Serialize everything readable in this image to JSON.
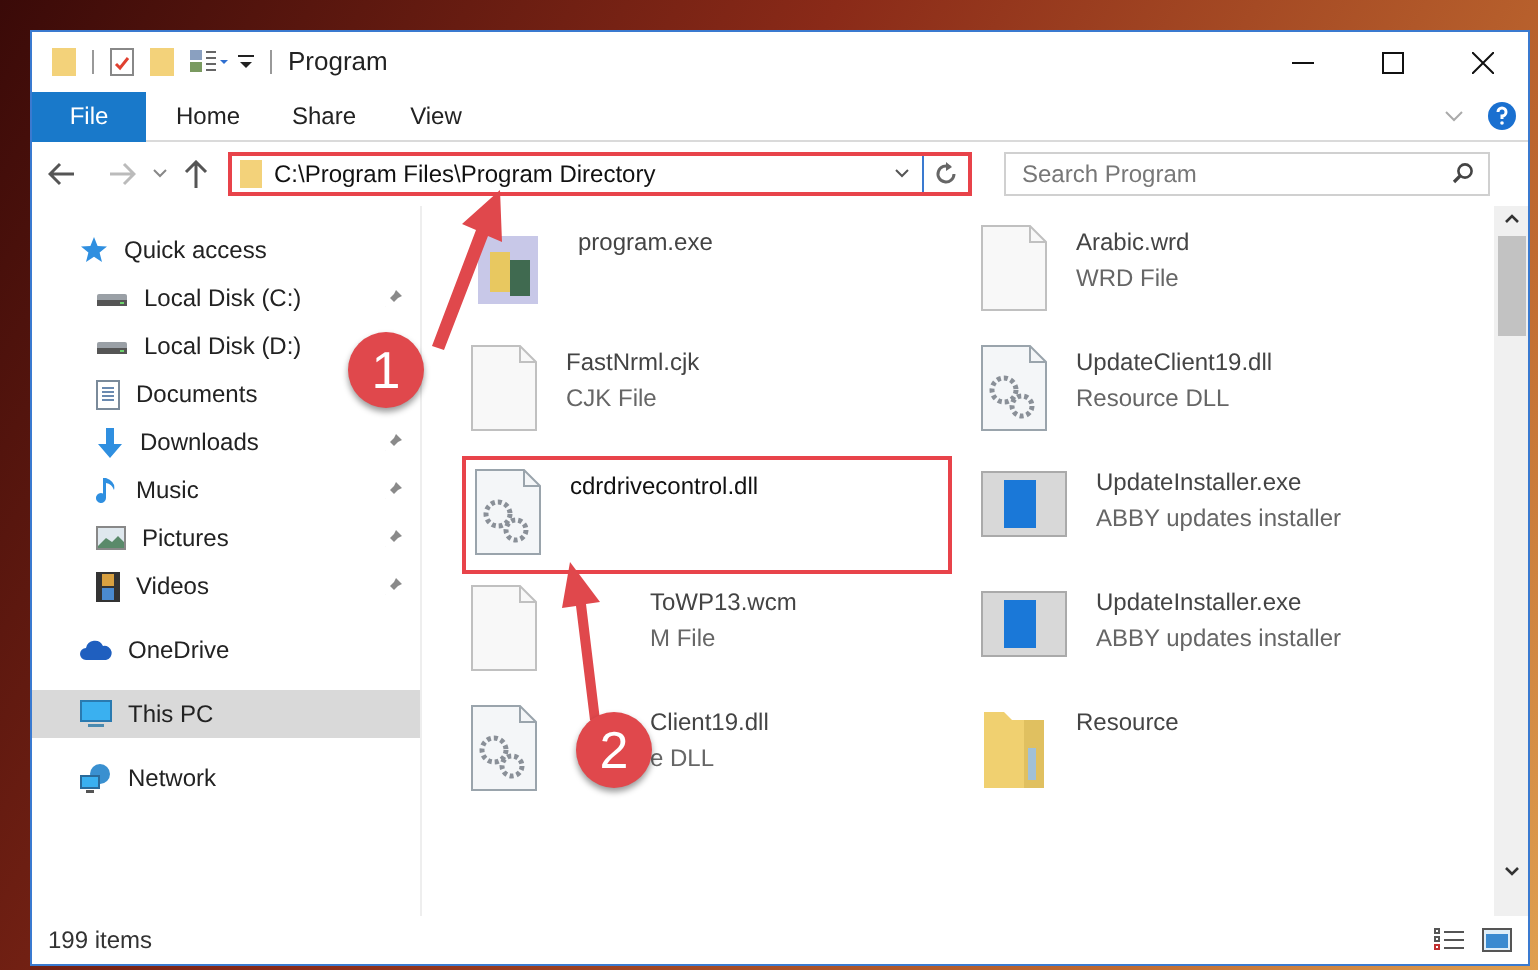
{
  "window": {
    "title": "Program"
  },
  "ribbon_tabs": [
    {
      "label": "File",
      "selected": true
    },
    {
      "label": "Home",
      "selected": false
    },
    {
      "label": "Share",
      "selected": false
    },
    {
      "label": "View",
      "selected": false
    }
  ],
  "address_bar": {
    "value": "C:\\Program Files\\Program Directory"
  },
  "search": {
    "placeholder": "Search Program"
  },
  "sidebar": {
    "items": [
      {
        "label": "Quick access",
        "kind": "star",
        "pinned": false,
        "selected": false,
        "children": [
          {
            "label": "Local Disk (C:)",
            "kind": "disk",
            "pinned": true,
            "selected": false
          },
          {
            "label": "Local Disk (D:)",
            "kind": "disk",
            "selected": false
          },
          {
            "label": "Documents",
            "kind": "doc",
            "selected": false
          },
          {
            "label": "Downloads",
            "kind": "download",
            "pinned": true,
            "selected": false
          },
          {
            "label": "Music",
            "kind": "music",
            "pinned": true,
            "selected": false
          },
          {
            "label": "Pictures",
            "kind": "picture",
            "pinned": true,
            "selected": false
          },
          {
            "label": "Videos",
            "kind": "video",
            "pinned": true,
            "selected": false
          }
        ]
      },
      {
        "label": "OneDrive",
        "kind": "cloud",
        "pinned": false,
        "selected": false
      },
      {
        "label": "This PC",
        "kind": "pc",
        "pinned": false,
        "selected": true
      },
      {
        "label": "Network",
        "kind": "network",
        "pinned": false,
        "selected": false
      }
    ]
  },
  "files": [
    {
      "name": "program.exe",
      "kind": "exe",
      "highlighted": false,
      "covered": false
    },
    {
      "name": "Arabic.wrd",
      "type": "WRD File",
      "kind": "blank",
      "highlighted": false,
      "covered": false
    },
    {
      "name": "FastNrml.cjk",
      "type": "CJK File",
      "kind": "blank",
      "highlighted": false,
      "covered": false
    },
    {
      "name": "UpdateClient19.dll",
      "type": "Resource DLL",
      "kind": "dll",
      "highlighted": false,
      "covered": false
    },
    {
      "name": "cdrdrivecontrol.dll",
      "kind": "dll",
      "highlighted": true,
      "covered": false
    },
    {
      "name": "UpdateInstaller.exe",
      "type": "ABBY updates installer",
      "kind": "installer",
      "highlighted": false,
      "covered": false
    },
    {
      "name": "ToWP13.wcm",
      "type": "M File",
      "kind": "blank",
      "highlighted": false,
      "covered": true
    },
    {
      "name": "UpdateInstaller.exe",
      "type": "ABBY updates installer",
      "kind": "installer",
      "highlighted": false,
      "covered": false
    },
    {
      "name": "Client19.dll",
      "type": "e DLL",
      "kind": "dll",
      "highlighted": false,
      "covered": true
    },
    {
      "name": "Resource",
      "kind": "folder",
      "highlighted": false,
      "covered": false
    }
  ],
  "status_bar": {
    "count": "199 items"
  },
  "annotations": [
    {
      "label": "1"
    },
    {
      "label": "2"
    }
  ]
}
